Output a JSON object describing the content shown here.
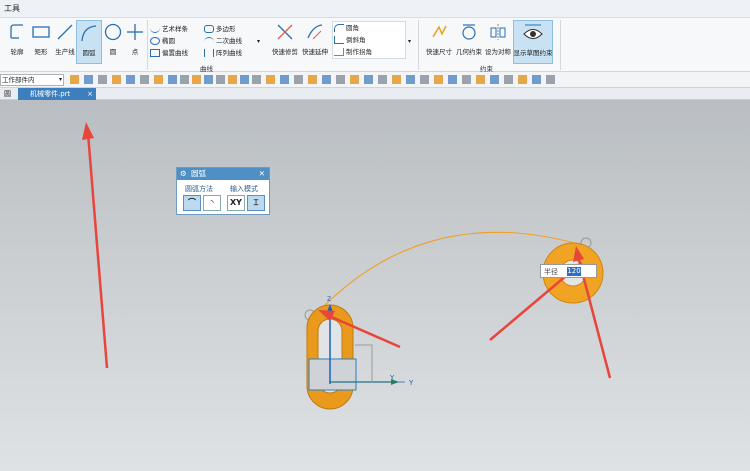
{
  "menu": {
    "tab": "工具"
  },
  "ribbon": {
    "tools_left": [
      {
        "label": "轮廓"
      },
      {
        "label": "矩形"
      },
      {
        "label": "生产线"
      },
      {
        "label": "圆弧"
      },
      {
        "label": "圆"
      },
      {
        "label": "点"
      }
    ],
    "curve_list_a": [
      "艺术样条",
      "椭圆",
      "偏置曲线"
    ],
    "curve_list_b": [
      "多边形",
      "二次曲线",
      "阵列曲线"
    ],
    "edit_tools": [
      {
        "label": "快速修剪"
      },
      {
        "label": "快速延伸"
      }
    ],
    "corner_list": [
      "圆角",
      "倒斜角",
      "制作拐角"
    ],
    "curve_group_label": "曲线",
    "constraint_tools": [
      {
        "label": "快速尺寸"
      },
      {
        "label": "几何约束"
      },
      {
        "label": "设为对称"
      },
      {
        "label": "显示草图约束"
      }
    ],
    "constraint_group_label": "约束"
  },
  "toolbar2": {
    "filter_value": "工作部件内"
  },
  "doctabs": {
    "first": "圆",
    "active": "机械零件.prt",
    "active_icon": "part-icon"
  },
  "dialog": {
    "title": "圆弧",
    "method_label": "圆弧方法",
    "input_label": "输入模式",
    "xy_label": "XY"
  },
  "radius_input": {
    "label": "半径",
    "value": "120"
  },
  "axis": {
    "y_label": "Y",
    "z_label": "Z",
    "x_label": "Y"
  },
  "colors": {
    "accent": "#4f8fc4",
    "part": "#f0a020",
    "arrow": "#e8453c",
    "highlight": "#2e6fc0"
  }
}
